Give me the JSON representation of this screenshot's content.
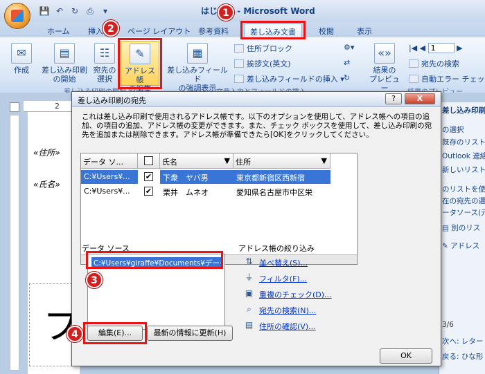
{
  "window": {
    "title": "はじめに - Microsoft Word"
  },
  "tabs": [
    {
      "label": "ホーム"
    },
    {
      "label": "挿入"
    },
    {
      "label": "ページ レイアウト"
    },
    {
      "label": "参考資料"
    },
    {
      "label": "差し込み文書"
    },
    {
      "label": "校閲"
    },
    {
      "label": "表示"
    }
  ],
  "ribbon": {
    "create": "作成",
    "start_merge": [
      "差し込み印刷",
      "の開始"
    ],
    "select_recipients": [
      "宛先の",
      "選択"
    ],
    "edit_address": [
      "アドレス帳",
      "の編集"
    ],
    "highlight_fields": [
      "差し込みフィールド",
      "の強調表示"
    ],
    "address_block": "住所ブロック",
    "greeting": "挨拶文(英文)",
    "insert_field": "差し込みフィールドの挿入",
    "preview": [
      "結果の",
      "プレビュー"
    ],
    "record_no": "1",
    "find_recipient": "宛先の検索",
    "auto_check": "自動エラー チェック",
    "group_start": "差し込み印刷の開始",
    "group_write": "文章入力とフィールドの挿入",
    "group_preview": "結果のプレビュー"
  },
  "document": {
    "ruler_num": "2",
    "field_address": "«住所»",
    "field_name": "«氏名»",
    "big_char": "フ"
  },
  "taskpane": {
    "lines": [
      "差し込み印刷",
      "の選択",
      "既存のリスト",
      "Outlook 連絡",
      "新しいリストの",
      "のリストを使用",
      "在の宛先の選",
      "ータソース(元",
      "別のリス",
      "アドレス",
      "3/6",
      "次へ: レター",
      "戻る: ひな形"
    ]
  },
  "dialog": {
    "title": "差し込み印刷の宛先",
    "help": "?",
    "close": "X",
    "description": "これは差し込み印刷で使用されるアドレス帳です。以下のオプションを使用して、アドレス帳への項目の追加、の項目の追加、アドレス帳の変更ができます。また、チェック ボックスを使用して、差し込み印刷の宛先を追加または削除できます。アドレス帳が準備できたら[OK]をクリックしてください。",
    "columns": [
      "データ ソ...",
      "",
      "氏名",
      "住所"
    ],
    "rows": [
      {
        "source": "C:¥Users¥...",
        "checked": "✔",
        "name": "下衆　ヤバ男",
        "address": "東京都新宿区西新宿"
      },
      {
        "source": "C:¥Users¥...",
        "checked": "✔",
        "name": "栗井　ムネオ",
        "address": "愛知県名古屋市中区栄"
      }
    ],
    "datasource_label": "データ ソース",
    "datasource_item": "C:¥Users¥giraffe¥Documents¥データ",
    "edit_button": "編集(E)...",
    "refresh_button": "最新の情報に更新(H)",
    "refine_label": "アドレス帳の絞り込み",
    "links": [
      "並べ替え(S)...",
      "フィルタ(F)...",
      "重複のチェック(D)...",
      "宛先の検索(N)...",
      "住所の確認(V)..."
    ],
    "ok": "OK"
  },
  "badges": [
    "1",
    "2",
    "3",
    "4"
  ],
  "colors": {
    "highlight": "#e11111",
    "selection": "#3875d6",
    "badge": "#d21f1f"
  }
}
